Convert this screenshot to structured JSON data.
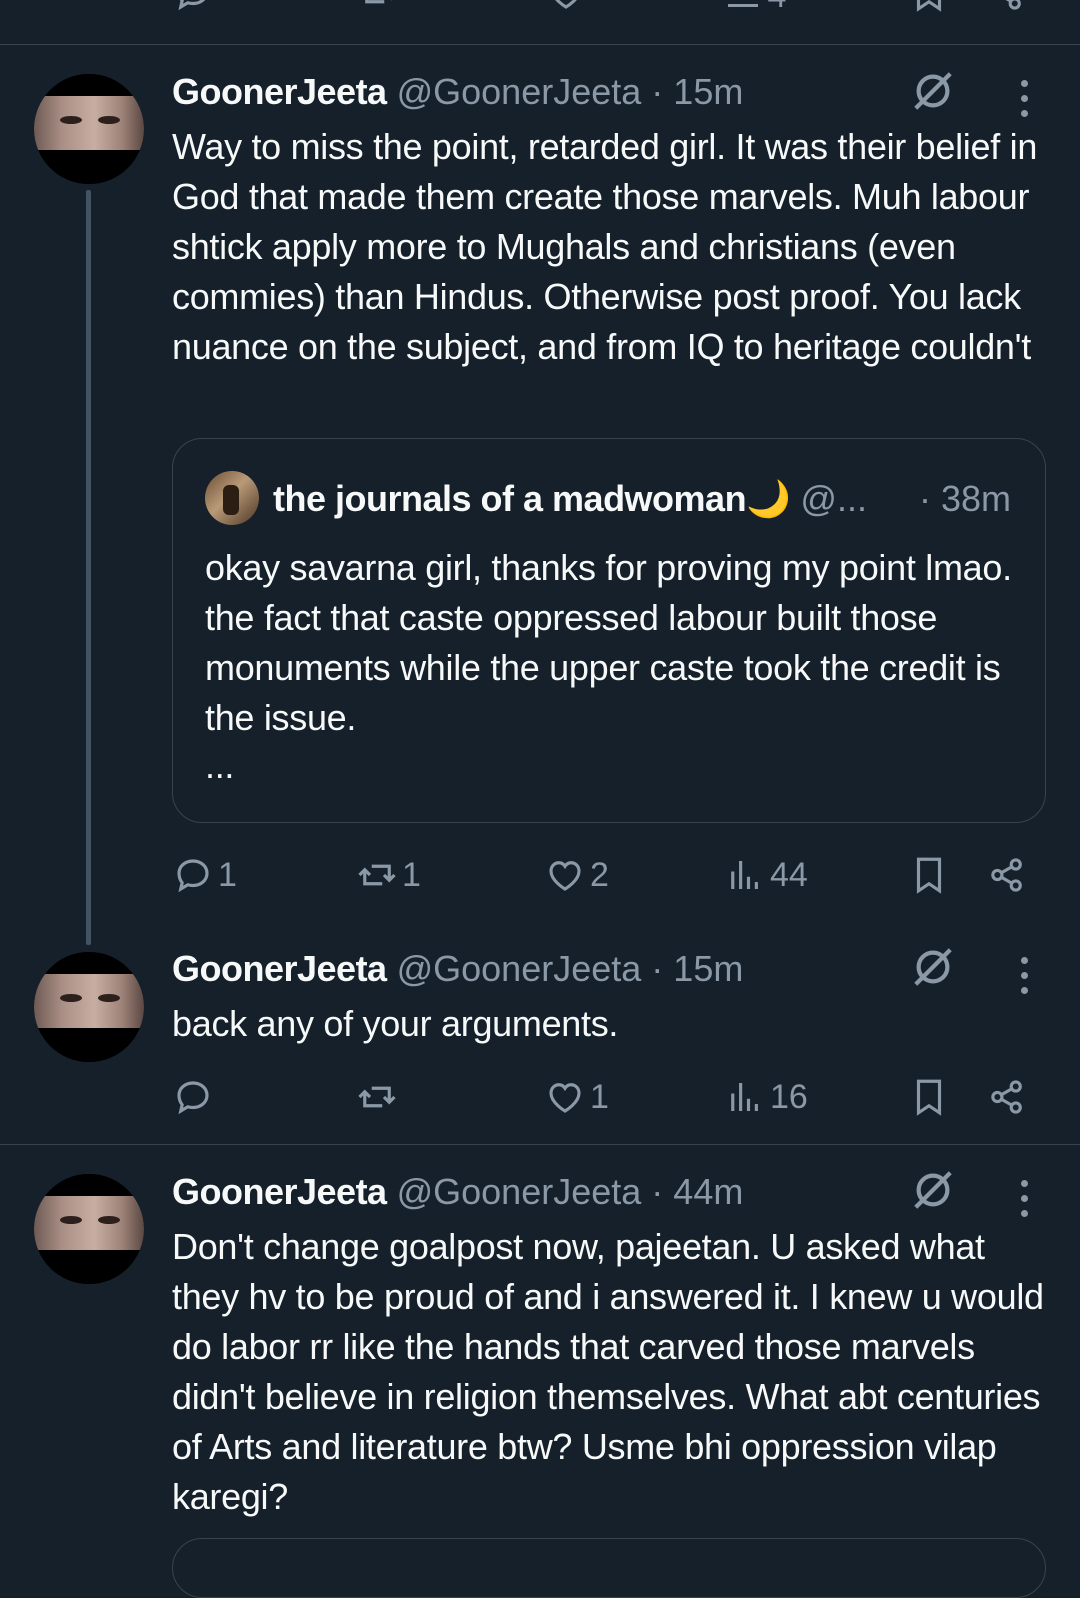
{
  "top_partial": {
    "views_partial": "4"
  },
  "tweets": [
    {
      "name": "GoonerJeeta",
      "handle": "@GoonerJeeta",
      "time": "15m",
      "text": "Way to miss the point, retarded girl. It was their belief in God that made them create those marvels. Muh labour shtick apply more to Mughals and christians (even commies) than Hindus. Otherwise post proof. You lack nuance on the subject, and from IQ to heritage couldn't",
      "quote": {
        "name": "the journals of a madwoman🌙",
        "handle": "@...",
        "time": "· 38m",
        "text": "okay savarna girl, thanks for proving my point lmao. the fact that caste oppressed labour built those monuments while the upper caste took the credit is the issue.",
        "more": "..."
      },
      "replies": "1",
      "reposts": "1",
      "likes": "2",
      "views": "44"
    },
    {
      "name": "GoonerJeeta",
      "handle": "@GoonerJeeta",
      "time": "15m",
      "text": "back any of your arguments.",
      "replies": "",
      "reposts": "",
      "likes": "1",
      "views": "16"
    },
    {
      "name": "GoonerJeeta",
      "handle": "@GoonerJeeta",
      "time": "44m",
      "text": "Don't change goalpost now, pajeetan. U asked what they hv to be proud of and i answered it. I knew u would do labor rr like the hands that carved those marvels didn't believe in religion themselves. What abt centuries of Arts and literature btw? Usme bhi oppression vilap karegi?"
    }
  ],
  "colors": {
    "background": "#15202b",
    "text": "#f7f9f9",
    "muted": "#8b98a5",
    "border": "#38444d"
  },
  "icons": [
    "reply-icon",
    "repost-icon",
    "like-icon",
    "views-icon",
    "bookmark-icon",
    "share-icon",
    "grok-icon",
    "more-icon"
  ]
}
